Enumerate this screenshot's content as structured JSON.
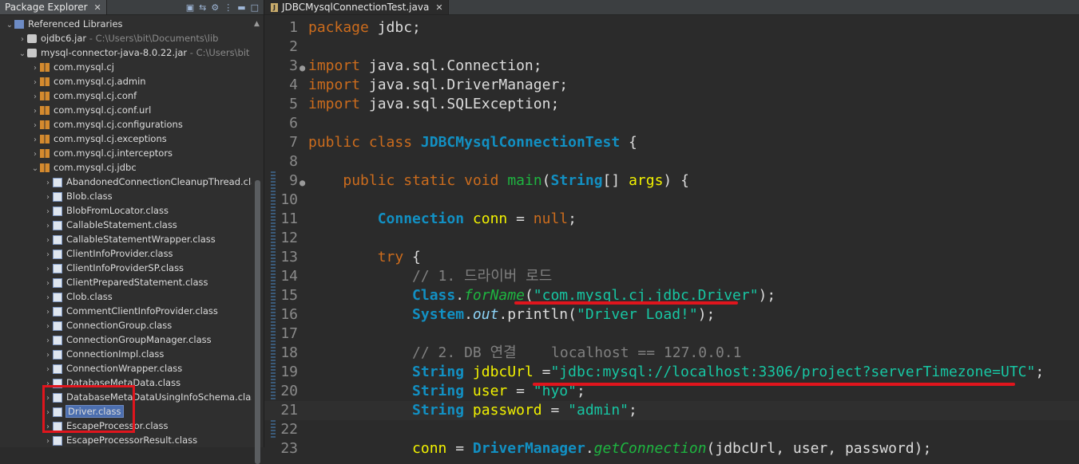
{
  "left_panel": {
    "title": "Package Explorer",
    "tree": [
      {
        "label": "Referenced Libraries",
        "indent": 0,
        "twisty": "v",
        "icon": "lib"
      },
      {
        "label": "ojdbc6.jar",
        "path": " - C:\\Users\\bit\\Documents\\lib",
        "indent": 1,
        "twisty": ">",
        "icon": "jar"
      },
      {
        "label": "mysql-connector-java-8.0.22.jar",
        "path": " - C:\\Users\\bit",
        "indent": 1,
        "twisty": "v",
        "icon": "jar"
      },
      {
        "label": "com.mysql.cj",
        "indent": 2,
        "twisty": ">",
        "icon": "pkg"
      },
      {
        "label": "com.mysql.cj.admin",
        "indent": 2,
        "twisty": ">",
        "icon": "pkg"
      },
      {
        "label": "com.mysql.cj.conf",
        "indent": 2,
        "twisty": ">",
        "icon": "pkg"
      },
      {
        "label": "com.mysql.cj.conf.url",
        "indent": 2,
        "twisty": ">",
        "icon": "pkg"
      },
      {
        "label": "com.mysql.cj.configurations",
        "indent": 2,
        "twisty": ">",
        "icon": "pkg"
      },
      {
        "label": "com.mysql.cj.exceptions",
        "indent": 2,
        "twisty": ">",
        "icon": "pkg"
      },
      {
        "label": "com.mysql.cj.interceptors",
        "indent": 2,
        "twisty": ">",
        "icon": "pkg"
      },
      {
        "label": "com.mysql.cj.jdbc",
        "indent": 2,
        "twisty": "v",
        "icon": "pkg"
      },
      {
        "label": "AbandonedConnectionCleanupThread.class",
        "indent": 3,
        "twisty": ">",
        "icon": "cls"
      },
      {
        "label": "Blob.class",
        "indent": 3,
        "twisty": ">",
        "icon": "cls"
      },
      {
        "label": "BlobFromLocator.class",
        "indent": 3,
        "twisty": ">",
        "icon": "cls"
      },
      {
        "label": "CallableStatement.class",
        "indent": 3,
        "twisty": ">",
        "icon": "cls"
      },
      {
        "label": "CallableStatementWrapper.class",
        "indent": 3,
        "twisty": ">",
        "icon": "cls"
      },
      {
        "label": "ClientInfoProvider.class",
        "indent": 3,
        "twisty": ">",
        "icon": "cls"
      },
      {
        "label": "ClientInfoProviderSP.class",
        "indent": 3,
        "twisty": ">",
        "icon": "cls"
      },
      {
        "label": "ClientPreparedStatement.class",
        "indent": 3,
        "twisty": ">",
        "icon": "cls"
      },
      {
        "label": "Clob.class",
        "indent": 3,
        "twisty": ">",
        "icon": "cls"
      },
      {
        "label": "CommentClientInfoProvider.class",
        "indent": 3,
        "twisty": ">",
        "icon": "cls"
      },
      {
        "label": "ConnectionGroup.class",
        "indent": 3,
        "twisty": ">",
        "icon": "cls"
      },
      {
        "label": "ConnectionGroupManager.class",
        "indent": 3,
        "twisty": ">",
        "icon": "cls"
      },
      {
        "label": "ConnectionImpl.class",
        "indent": 3,
        "twisty": ">",
        "icon": "cls"
      },
      {
        "label": "ConnectionWrapper.class",
        "indent": 3,
        "twisty": ">",
        "icon": "cls"
      },
      {
        "label": "DatabaseMetaData.class",
        "indent": 3,
        "twisty": ">",
        "icon": "cls"
      },
      {
        "label": "DatabaseMetaDataUsingInfoSchema.class",
        "indent": 3,
        "twisty": ">",
        "icon": "cls"
      },
      {
        "label": "Driver.class",
        "indent": 3,
        "twisty": ">",
        "icon": "cls",
        "selected": true
      },
      {
        "label": "EscapeProcessor.class",
        "indent": 3,
        "twisty": ">",
        "icon": "cls"
      },
      {
        "label": "EscapeProcessorResult.class",
        "indent": 3,
        "twisty": ">",
        "icon": "cls"
      }
    ]
  },
  "editor": {
    "tab_title": "JDBCMysqlConnectionTest.java",
    "lines": [
      {
        "n": "1",
        "tokens": [
          [
            "kw",
            "package"
          ],
          [
            "mu",
            " jdbc;"
          ]
        ]
      },
      {
        "n": "2",
        "tokens": []
      },
      {
        "n": "3",
        "fold": true,
        "tokens": [
          [
            "kw",
            "import"
          ],
          [
            "mu",
            " java.sql.Connection;"
          ]
        ]
      },
      {
        "n": "4",
        "tokens": [
          [
            "kw",
            "import"
          ],
          [
            "mu",
            " java.sql.DriverManager;"
          ]
        ]
      },
      {
        "n": "5",
        "tokens": [
          [
            "kw",
            "import"
          ],
          [
            "mu",
            " java.sql.SQLException;"
          ]
        ]
      },
      {
        "n": "6",
        "tokens": []
      },
      {
        "n": "7",
        "tokens": [
          [
            "kw",
            "public"
          ],
          [
            "mu",
            " "
          ],
          [
            "kw",
            "class"
          ],
          [
            "mu",
            " "
          ],
          [
            "cn",
            "JDBCMysqlConnectionTest"
          ],
          [
            "mu",
            " {"
          ]
        ]
      },
      {
        "n": "8",
        "tokens": []
      },
      {
        "n": "9",
        "fold": true,
        "tokens": [
          [
            "mu",
            "    "
          ],
          [
            "kw",
            "public"
          ],
          [
            "mu",
            " "
          ],
          [
            "kw",
            "static"
          ],
          [
            "mu",
            " "
          ],
          [
            "kw",
            "void"
          ],
          [
            "mu",
            " "
          ],
          [
            "fn",
            "main"
          ],
          [
            "mu",
            "("
          ],
          [
            "tp",
            "String"
          ],
          [
            "mu",
            "[] "
          ],
          [
            "vr",
            "args"
          ],
          [
            "mu",
            ") {"
          ]
        ]
      },
      {
        "n": "10",
        "tokens": []
      },
      {
        "n": "11",
        "tokens": [
          [
            "mu",
            "        "
          ],
          [
            "tp",
            "Connection"
          ],
          [
            "mu",
            " "
          ],
          [
            "vr",
            "conn"
          ],
          [
            "mu",
            " = "
          ],
          [
            "nl",
            "null"
          ],
          [
            "mu",
            ";"
          ]
        ]
      },
      {
        "n": "12",
        "tokens": []
      },
      {
        "n": "13",
        "tokens": [
          [
            "mu",
            "        "
          ],
          [
            "kw",
            "try"
          ],
          [
            "mu",
            " {"
          ]
        ]
      },
      {
        "n": "14",
        "tokens": [
          [
            "mu",
            "            "
          ],
          [
            "cm",
            "// 1. 드라이버 로드"
          ]
        ]
      },
      {
        "n": "15",
        "tokens": [
          [
            "mu",
            "            "
          ],
          [
            "tp",
            "Class"
          ],
          [
            "mu",
            "."
          ],
          [
            "fn it",
            "forName"
          ],
          [
            "mu",
            "("
          ],
          [
            "st",
            "\"com.mysql.cj.jdbc.Driver\""
          ],
          [
            "mu",
            ");"
          ]
        ]
      },
      {
        "n": "16",
        "tokens": [
          [
            "mu",
            "            "
          ],
          [
            "tp",
            "System"
          ],
          [
            "mu",
            "."
          ],
          [
            "fd",
            "out"
          ],
          [
            "mu",
            ".println("
          ],
          [
            "st",
            "\"Driver Load!\""
          ],
          [
            "mu",
            ");"
          ]
        ]
      },
      {
        "n": "17",
        "tokens": []
      },
      {
        "n": "18",
        "tokens": [
          [
            "mu",
            "            "
          ],
          [
            "cm",
            "// 2. DB 연결    localhost == 127.0.0.1"
          ]
        ]
      },
      {
        "n": "19",
        "tokens": [
          [
            "mu",
            "            "
          ],
          [
            "tp",
            "String"
          ],
          [
            "mu",
            " "
          ],
          [
            "vr",
            "jdbcUrl"
          ],
          [
            "mu",
            " ="
          ],
          [
            "st",
            "\"jdbc:mysql://localhost:3306/project?serverTimezone=UTC\""
          ],
          [
            "mu",
            ";"
          ]
        ]
      },
      {
        "n": "20",
        "tokens": [
          [
            "mu",
            "            "
          ],
          [
            "tp",
            "String"
          ],
          [
            "mu",
            " "
          ],
          [
            "vr",
            "user"
          ],
          [
            "mu",
            " = "
          ],
          [
            "st",
            "\"hyo\""
          ],
          [
            "mu",
            ";"
          ]
        ]
      },
      {
        "n": "21",
        "current": true,
        "tokens": [
          [
            "mu",
            "            "
          ],
          [
            "tp",
            "String"
          ],
          [
            "mu",
            " "
          ],
          [
            "vr",
            "password"
          ],
          [
            "mu",
            " = "
          ],
          [
            "st",
            "\"admin\""
          ],
          [
            "mu",
            ";"
          ]
        ]
      },
      {
        "n": "22",
        "tokens": []
      },
      {
        "n": "23",
        "tokens": [
          [
            "mu",
            "            "
          ],
          [
            "vr",
            "conn"
          ],
          [
            "mu",
            " = "
          ],
          [
            "tp",
            "DriverManager"
          ],
          [
            "mu",
            "."
          ],
          [
            "fn it",
            "getConnection"
          ],
          [
            "mu",
            "(jdbcUrl, user, password);"
          ]
        ]
      }
    ]
  }
}
